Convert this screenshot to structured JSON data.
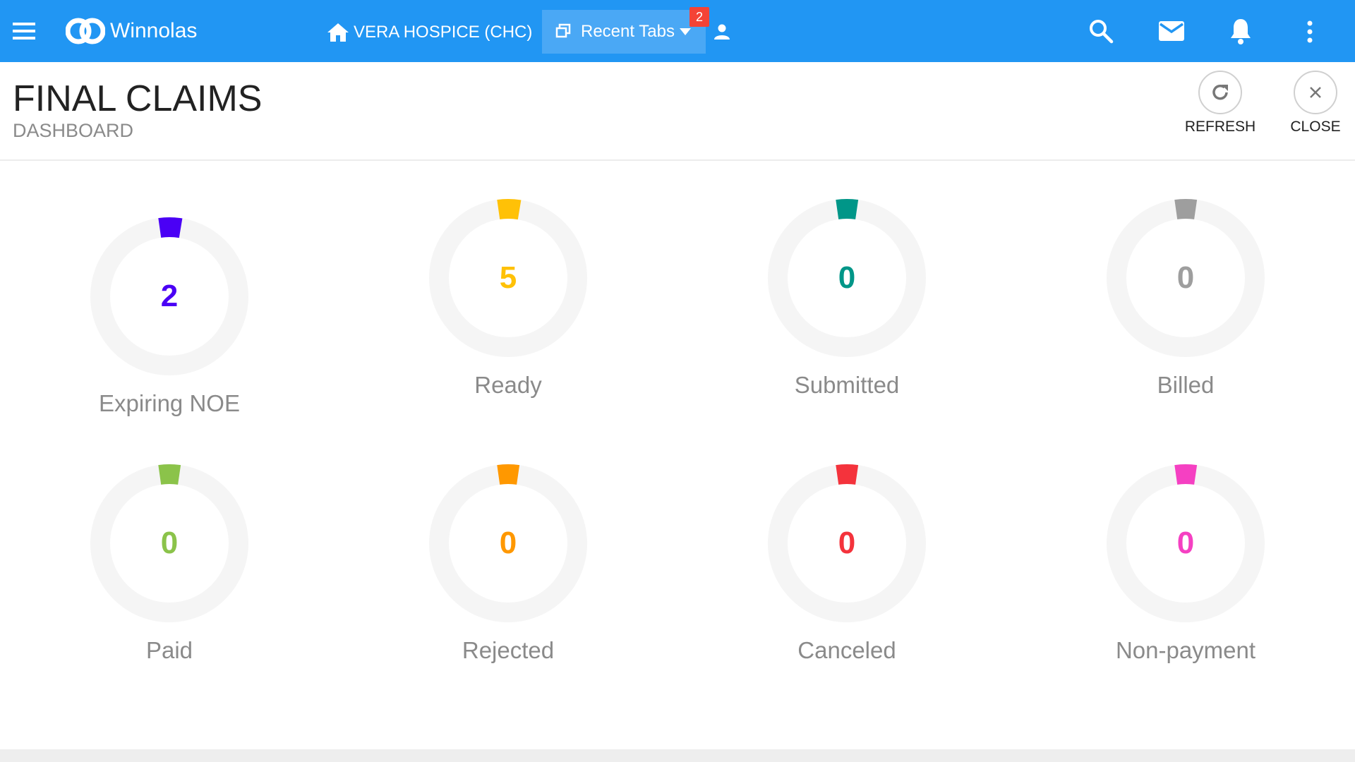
{
  "topbar": {
    "brand": "Winnolas",
    "organization": "VERA HOSPICE (CHC)",
    "recent_tabs_label": "Recent Tabs",
    "recent_tabs_count": "2",
    "bg_color": "#2196f3"
  },
  "header": {
    "title": "FINAL CLAIMS",
    "subtitle": "DASHBOARD",
    "refresh_label": "REFRESH",
    "close_label": "CLOSE"
  },
  "tiles": [
    {
      "label": "Expiring NOE",
      "value": "2",
      "color": "#4a00f5"
    },
    {
      "label": "Ready",
      "value": "5",
      "color": "#ffc107"
    },
    {
      "label": "Submitted",
      "value": "0",
      "color": "#009688"
    },
    {
      "label": "Billed",
      "value": "0",
      "color": "#9e9e9e"
    },
    {
      "label": "Paid",
      "value": "0",
      "color": "#8bc34a"
    },
    {
      "label": "Rejected",
      "value": "0",
      "color": "#ff9800"
    },
    {
      "label": "Canceled",
      "value": "0",
      "color": "#f4333c"
    },
    {
      "label": "Non-payment",
      "value": "0",
      "color": "#f540c2"
    }
  ]
}
